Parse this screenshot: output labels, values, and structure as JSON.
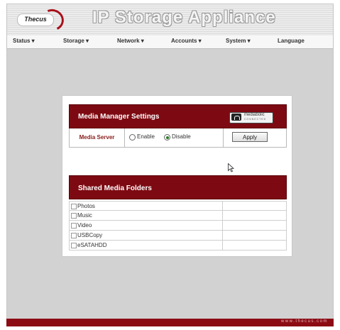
{
  "app": {
    "brand": "Thecus",
    "title": "IP Storage Appliance"
  },
  "menu": {
    "items": [
      {
        "label": "Status ▾"
      },
      {
        "label": "Storage ▾"
      },
      {
        "label": "Network ▾"
      },
      {
        "label": "Accounts ▾"
      },
      {
        "label": "System ▾"
      },
      {
        "label": "Language"
      }
    ]
  },
  "media_manager": {
    "title": "Media Manager Settings",
    "logo_text": "mediabolic",
    "logo_subtext": "CONNECTED",
    "server_label": "Media Server",
    "enable_label": "Enable",
    "disable_label": "Disable",
    "selected": "Disable",
    "apply_label": "Apply"
  },
  "shared_folders": {
    "title": "Shared Media Folders",
    "items": [
      {
        "name": "Photos",
        "checked": false
      },
      {
        "name": "Music",
        "checked": false
      },
      {
        "name": "Video",
        "checked": false
      },
      {
        "name": "USBCopy",
        "checked": false
      },
      {
        "name": "eSATAHDD",
        "checked": false
      }
    ]
  },
  "footer": {
    "url": "www.thecus.com"
  },
  "colors": {
    "accent": "#7d0a12",
    "background": "#d2d2d2"
  }
}
